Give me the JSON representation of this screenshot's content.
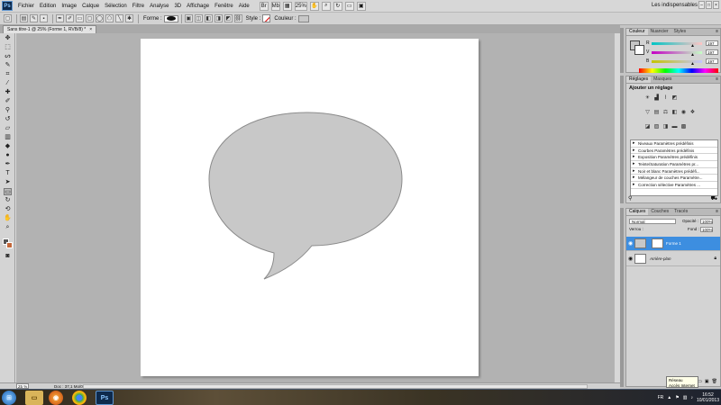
{
  "app": {
    "logo": "Ps",
    "workspace": "Les indispensables",
    "zoom": "25%"
  },
  "menu": [
    "Fichier",
    "Edition",
    "Image",
    "Calque",
    "Sélection",
    "Filtre",
    "Analyse",
    "3D",
    "Affichage",
    "Fenêtre",
    "Aide"
  ],
  "options": {
    "shape_label": "Forme :",
    "style_label": "Style :",
    "color_label": "Couleur :"
  },
  "document": {
    "tab_title": "Sans titre-1 @ 25% (Forme 1, RVB/8) *",
    "close": "×"
  },
  "status": {
    "zoom": "25 %",
    "doc_info": "Doc : 37,1 Mo/0 octets",
    "arrow": "▸"
  },
  "color_panel": {
    "tabs": [
      "Couleur",
      "Nuancier",
      "Styles"
    ],
    "sliders": [
      {
        "label": "R",
        "value": "197"
      },
      {
        "label": "V",
        "value": "197"
      },
      {
        "label": "B",
        "value": "197"
      }
    ],
    "fg_color": "#c5c5c5",
    "bg_color": "#ffffff"
  },
  "adjustments": {
    "tabs": [
      "Réglages",
      "Masques"
    ],
    "title": "Ajouter un réglage",
    "presets": [
      "Niveaux Paramètres prédéfinis",
      "Courbes Paramètres prédéfinis",
      "Exposition Paramètres prédéfinis",
      "Teinte/Saturation Paramètres pr...",
      "Noir et blanc Paramètres prédéfi...",
      "Mélangeur de couches Paramètre...",
      "Correction sélective Paramètres ..."
    ]
  },
  "layers": {
    "tabs": [
      "Calques",
      "Couches",
      "Tracés"
    ],
    "blend_mode": "Normal",
    "opacity_label": "Opacité :",
    "opacity": "100%",
    "lock_label": "Verrou :",
    "fill_label": "Fond :",
    "fill": "100%",
    "items": [
      {
        "name": "Forme 1",
        "selected": true
      },
      {
        "name": "Arrière-plan",
        "selected": false
      }
    ]
  },
  "taskbar": {
    "lang": "FR",
    "time": "16:52",
    "date": "10/01/2013",
    "tooltip_line1": "Réseau",
    "tooltip_line2": "Accès Internet"
  },
  "colors": {
    "selection": "#3d8ee0",
    "shape_fill": "#c8c8c8",
    "shape_stroke": "#8a8a8a"
  },
  "icons": [
    "photoshop-logo",
    "speech-bubble-shape",
    "eye-icon",
    "lock-icon",
    "windows-start",
    "explorer-icon",
    "firefox-icon",
    "chrome-icon",
    "photoshop-taskbar-icon"
  ]
}
